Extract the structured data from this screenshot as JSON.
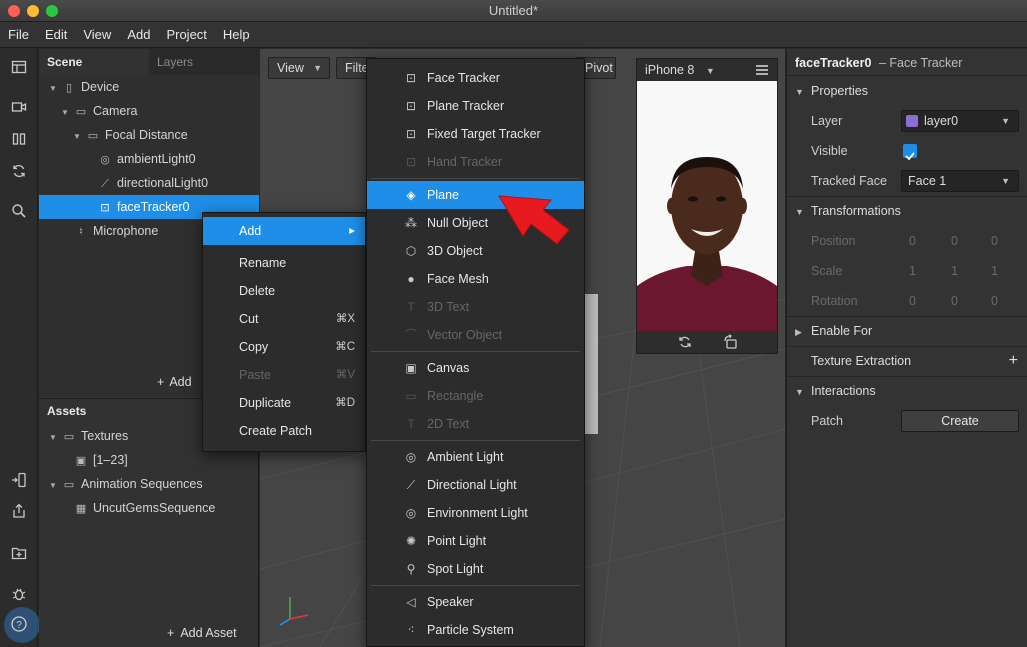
{
  "window": {
    "title": "Untitled*"
  },
  "menubar": [
    "File",
    "Edit",
    "View",
    "Add",
    "Project",
    "Help"
  ],
  "toolstrip": {
    "top": [
      "layout-icon",
      "video-icon",
      "columns-icon",
      "sync-icon",
      "search-icon"
    ],
    "bottom": [
      "device-import-icon",
      "share-icon",
      "folder-add-icon",
      "bug-icon",
      "help-icon"
    ]
  },
  "scene": {
    "tab_scene": "Scene",
    "tab_layers": "Layers",
    "tree": [
      {
        "label": "Device",
        "icon": "phone-icon",
        "level": 0,
        "twisty": "▼"
      },
      {
        "label": "Camera",
        "icon": "camera-icon",
        "level": 1,
        "twisty": "▼"
      },
      {
        "label": "Focal Distance",
        "icon": "focal-icon",
        "level": 2,
        "twisty": "▼"
      },
      {
        "label": "ambientLight0",
        "icon": "globe-icon",
        "level": 3,
        "twisty": ""
      },
      {
        "label": "directionalLight0",
        "icon": "directional-light-icon",
        "level": 3,
        "twisty": ""
      },
      {
        "label": "faceTracker0",
        "icon": "face-tracker-icon",
        "level": 3,
        "twisty": "",
        "selected": true
      },
      {
        "label": "Microphone",
        "icon": "microphone-icon",
        "level": 1,
        "twisty": ""
      }
    ],
    "add_label": "Add"
  },
  "assets": {
    "title": "Assets",
    "tree": [
      {
        "label": "Textures",
        "icon": "folder-icon",
        "level": 0,
        "twisty": "▼"
      },
      {
        "label": "[1–23]",
        "icon": "image-icon",
        "level": 1,
        "twisty": ""
      },
      {
        "label": "Animation Sequences",
        "icon": "folder-icon",
        "level": 0,
        "twisty": "▼"
      },
      {
        "label": "UncutGemsSequence",
        "icon": "sequence-icon",
        "level": 1,
        "twisty": ""
      }
    ],
    "add_asset": "Add Asset"
  },
  "viewport": {
    "view_button": "View",
    "filter_button": "Filte",
    "pivot_button": "Pivot",
    "device": "iPhone 8"
  },
  "context_menu": [
    {
      "label": "Add",
      "shortcut": "▸",
      "disabled": false,
      "highlight": true
    },
    {
      "label": "Rename",
      "shortcut": "",
      "disabled": false
    },
    {
      "label": "Delete",
      "shortcut": "",
      "disabled": false
    },
    {
      "label": "Cut",
      "shortcut": "⌘X",
      "disabled": false
    },
    {
      "label": "Copy",
      "shortcut": "⌘C",
      "disabled": false
    },
    {
      "label": "Paste",
      "shortcut": "⌘V",
      "disabled": true
    },
    {
      "label": "Duplicate",
      "shortcut": "⌘D",
      "disabled": false
    },
    {
      "label": "Create Patch",
      "shortcut": "",
      "disabled": false
    }
  ],
  "add_submenu": [
    {
      "label": "Face Tracker",
      "icon": "face-tracker-icon",
      "disabled": false
    },
    {
      "label": "Plane Tracker",
      "icon": "plane-tracker-icon",
      "disabled": false
    },
    {
      "label": "Fixed Target Tracker",
      "icon": "target-tracker-icon",
      "disabled": false
    },
    {
      "label": "Hand Tracker",
      "icon": "hand-tracker-icon",
      "disabled": true,
      "sep_after": true
    },
    {
      "label": "Plane",
      "icon": "plane-icon",
      "disabled": false,
      "highlight": true
    },
    {
      "label": "Null Object",
      "icon": "null-object-icon",
      "disabled": false
    },
    {
      "label": "3D Object",
      "icon": "cube-icon",
      "disabled": false
    },
    {
      "label": "Face Mesh",
      "icon": "face-mesh-icon",
      "disabled": false
    },
    {
      "label": "3D Text",
      "icon": "text-icon",
      "disabled": true
    },
    {
      "label": "Vector Object",
      "icon": "vector-icon",
      "disabled": true,
      "sep_after": true
    },
    {
      "label": "Canvas",
      "icon": "canvas-icon",
      "disabled": false
    },
    {
      "label": "Rectangle",
      "icon": "rectangle-icon",
      "disabled": true
    },
    {
      "label": "2D Text",
      "icon": "text-icon",
      "disabled": true,
      "sep_after": true
    },
    {
      "label": "Ambient Light",
      "icon": "globe-icon",
      "disabled": false
    },
    {
      "label": "Directional Light",
      "icon": "directional-light-icon",
      "disabled": false
    },
    {
      "label": "Environment Light",
      "icon": "globe-icon",
      "disabled": false
    },
    {
      "label": "Point Light",
      "icon": "point-light-icon",
      "disabled": false
    },
    {
      "label": "Spot Light",
      "icon": "spot-light-icon",
      "disabled": false,
      "sep_after": true
    },
    {
      "label": "Speaker",
      "icon": "speaker-icon",
      "disabled": false
    },
    {
      "label": "Particle System",
      "icon": "particles-icon",
      "disabled": false
    }
  ],
  "inspector": {
    "object_name": "faceTracker0",
    "object_type": "– Face Tracker",
    "properties": "Properties",
    "layer_label": "Layer",
    "layer_value": "layer0",
    "layer_color": "#8e6fd1",
    "visible_label": "Visible",
    "visible_checked": true,
    "tracked_face_label": "Tracked Face",
    "tracked_face_value": "Face 1",
    "transformations": "Transformations",
    "position_label": "Position",
    "scale_label": "Scale",
    "rotation_label": "Rotation",
    "position": [
      "0",
      "0",
      "0"
    ],
    "scale": [
      "1",
      "1",
      "1"
    ],
    "rotation": [
      "0",
      "0",
      "0"
    ],
    "enable_for": "Enable For",
    "texture_extraction": "Texture Extraction",
    "interactions": "Interactions",
    "patch_label": "Patch",
    "create_button": "Create"
  },
  "colors": {
    "accent": "#1e8ee9",
    "arrow": "#e8191f"
  }
}
